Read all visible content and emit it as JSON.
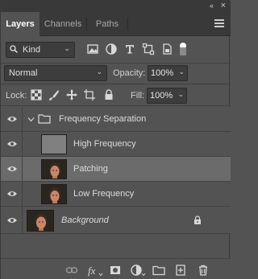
{
  "window": {
    "collapse_glyph": "«",
    "close_glyph": "×"
  },
  "tabs": [
    {
      "label": "Layers",
      "active": true
    },
    {
      "label": "Channels",
      "active": false
    },
    {
      "label": "Paths",
      "active": false
    }
  ],
  "filter": {
    "kind_label": "Kind",
    "filter_icons": [
      "image-filter-icon",
      "adjustment-filter-icon",
      "type-filter-icon",
      "shape-filter-icon",
      "smart-object-filter-icon"
    ]
  },
  "blend": {
    "mode": "Normal",
    "opacity_label": "Opacity:",
    "opacity_value": "100%"
  },
  "lock": {
    "label": "Lock:",
    "fill_label": "Fill:",
    "fill_value": "100%"
  },
  "layers": [
    {
      "name": "Frequency Separation",
      "type": "group",
      "selected": false
    },
    {
      "name": "High Frequency",
      "type": "gray",
      "selected": false
    },
    {
      "name": "Patching",
      "type": "photo",
      "selected": true
    },
    {
      "name": "Low Frequency",
      "type": "photo",
      "selected": false
    },
    {
      "name": "Background",
      "type": "photo",
      "selected": false,
      "locked": true
    }
  ],
  "bottom_icons": [
    "link-icon",
    "fx-icon",
    "mask-icon",
    "adjustment-icon",
    "folder-icon",
    "new-layer-icon",
    "trash-icon"
  ],
  "colors": {
    "panel_bg": "#535353",
    "tabbar_bg": "#393939",
    "selected_row": "#6b6b6b"
  }
}
